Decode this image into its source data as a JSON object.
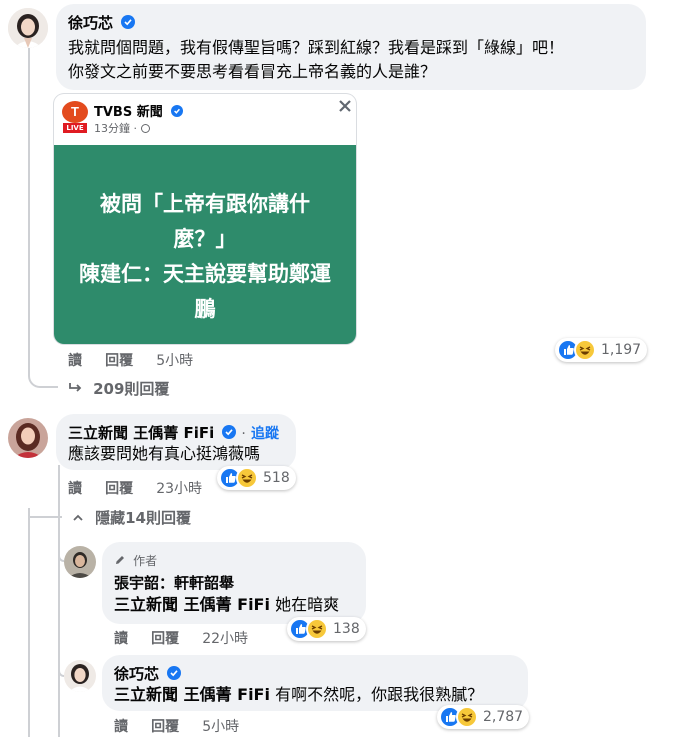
{
  "comment1": {
    "author": "徐巧芯",
    "text_line1": "我就問個問題，我有假傳聖旨嗎？踩到紅線？我看是踩到「綠線」吧！",
    "text_line2": "你發文之前要不要思考看看冒充上帝名義的人是誰？",
    "shared_post": {
      "page_name": "TVBS 新聞",
      "logo_text": "T",
      "live_label": "LIVE",
      "time": "13分鐘",
      "headline_line1": "被問「上帝有跟你講什",
      "headline_line2": "麼？」",
      "headline_line3": "陳建仁：天主說要幫助鄭運",
      "headline_line4": "鵬",
      "card_color": "#2e8b6b"
    },
    "actions": {
      "read": "讀",
      "reply": "回覆",
      "time": "5小時"
    },
    "reaction_count": "1,197",
    "replies_link": "209則回覆"
  },
  "comment2": {
    "author": "三立新聞 王偊菁 FiFi",
    "follow": "追蹤",
    "text": "應該要問她有真心挺鴻薇嗎",
    "actions": {
      "read": "讀",
      "reply": "回覆",
      "time": "23小時"
    },
    "reaction_count": "518",
    "hide_replies": "隱藏14則回覆"
  },
  "reply1": {
    "badge": "作者",
    "author": "張宇韶：軒軒韶舉",
    "mention": "三立新聞 王偊菁 FiFi",
    "text": " 她在暗爽",
    "actions": {
      "read": "讀",
      "reply": "回覆",
      "time": "22小時"
    },
    "reaction_count": "138"
  },
  "reply2": {
    "author": "徐巧芯",
    "mention": "三立新聞 王偊菁 FiFi",
    "text": " 有啊不然呢，你跟我很熟膩？",
    "actions": {
      "read": "讀",
      "reply": "回覆",
      "time": "5小時"
    },
    "reaction_count": "2,787"
  },
  "colors": {
    "accent": "#1877f2",
    "bubble": "#f0f2f5",
    "muted": "#65676b"
  }
}
